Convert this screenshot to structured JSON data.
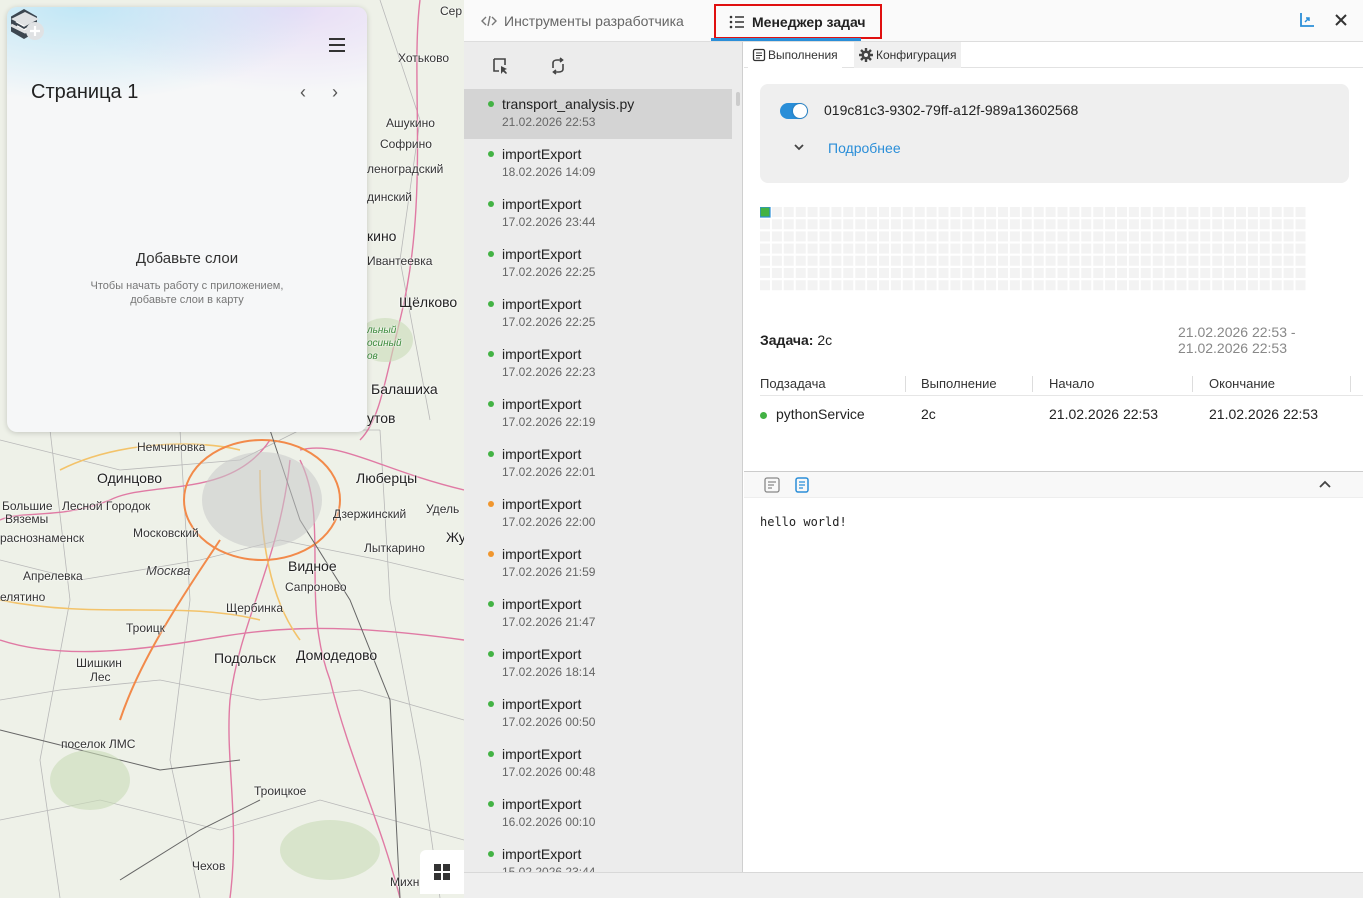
{
  "map": {
    "labels": [
      {
        "text": "Сер",
        "cls": ""
      },
      {
        "text": "Хотьково",
        "cls": ""
      },
      {
        "text": "Ашукино",
        "cls": ""
      },
      {
        "text": "Софрино",
        "cls": ""
      },
      {
        "text": "леноградский",
        "cls": ""
      },
      {
        "text": "динский",
        "cls": ""
      },
      {
        "text": "кино",
        "cls": "big"
      },
      {
        "text": "Ивантеевка",
        "cls": ""
      },
      {
        "text": "Щёлково",
        "cls": "big"
      },
      {
        "text": "Балашиха",
        "cls": "big"
      },
      {
        "text": "утов",
        "cls": "big"
      },
      {
        "text": "Немчиновка",
        "cls": ""
      },
      {
        "text": "Одинцово",
        "cls": "big"
      },
      {
        "text": "Люберцы",
        "cls": "big"
      },
      {
        "text": "Большие",
        "cls": ""
      },
      {
        "text": "Лесной Городок",
        "cls": ""
      },
      {
        "text": "Дзержинский",
        "cls": ""
      },
      {
        "text": "Удель",
        "cls": ""
      },
      {
        "text": "Вяземы",
        "cls": ""
      },
      {
        "text": "Московский",
        "cls": ""
      },
      {
        "text": "раснознаменск",
        "cls": ""
      },
      {
        "text": "Жу",
        "cls": "big"
      },
      {
        "text": "Лыткарино",
        "cls": ""
      },
      {
        "text": "Апрелевка",
        "cls": ""
      },
      {
        "text": "Москва",
        "cls": "city"
      },
      {
        "text": "Видное",
        "cls": "big"
      },
      {
        "text": "Сапроново",
        "cls": ""
      },
      {
        "text": "елятино",
        "cls": ""
      },
      {
        "text": "Щербинка",
        "cls": ""
      },
      {
        "text": "Троицк",
        "cls": ""
      },
      {
        "text": "Подольск",
        "cls": "big"
      },
      {
        "text": "Домодедово",
        "cls": "big"
      },
      {
        "text": "Шишкин",
        "cls": ""
      },
      {
        "text": "Лес",
        "cls": ""
      },
      {
        "text": "поселок ЛМС",
        "cls": ""
      },
      {
        "text": "Троицкое",
        "cls": ""
      },
      {
        "text": "Чехов",
        "cls": ""
      },
      {
        "text": "Михн",
        "cls": ""
      },
      {
        "text": "льный",
        "cls": "green"
      },
      {
        "text": "осиный",
        "cls": "green"
      },
      {
        "text": "ов",
        "cls": "green"
      }
    ]
  },
  "layers_panel": {
    "title": "Страница 1",
    "empty_title": "Добавьте слои",
    "empty_text": "Чтобы начать работу с приложением, добавьте слои в карту"
  },
  "tabs": {
    "devtools": "Инструменты разработчика",
    "tasks": "Менеджер задач"
  },
  "tasks": [
    {
      "name": "transport_analysis.py",
      "date": "21.02.2026 22:53",
      "status": "#43b244",
      "selected": true
    },
    {
      "name": "importExport",
      "date": "18.02.2026 14:09",
      "status": "#43b244"
    },
    {
      "name": "importExport",
      "date": "17.02.2026 23:44",
      "status": "#43b244"
    },
    {
      "name": "importExport",
      "date": "17.02.2026 22:25",
      "status": "#43b244"
    },
    {
      "name": "importExport",
      "date": "17.02.2026 22:25",
      "status": "#43b244"
    },
    {
      "name": "importExport",
      "date": "17.02.2026 22:23",
      "status": "#43b244"
    },
    {
      "name": "importExport",
      "date": "17.02.2026 22:19",
      "status": "#43b244"
    },
    {
      "name": "importExport",
      "date": "17.02.2026 22:01",
      "status": "#43b244"
    },
    {
      "name": "importExport",
      "date": "17.02.2026 22:00",
      "status": "#f0962e"
    },
    {
      "name": "importExport",
      "date": "17.02.2026 21:59",
      "status": "#f0962e"
    },
    {
      "name": "importExport",
      "date": "17.02.2026 21:47",
      "status": "#43b244"
    },
    {
      "name": "importExport",
      "date": "17.02.2026 18:14",
      "status": "#43b244"
    },
    {
      "name": "importExport",
      "date": "17.02.2026 00:50",
      "status": "#43b244"
    },
    {
      "name": "importExport",
      "date": "17.02.2026 00:48",
      "status": "#43b244"
    },
    {
      "name": "importExport",
      "date": "16.02.2026 00:10",
      "status": "#43b244"
    },
    {
      "name": "importExport",
      "date": "15.02.2026 23:44",
      "status": "#43b244"
    }
  ],
  "details": {
    "subtabs": {
      "runs": "Выполнения",
      "config": "Конфигурация"
    },
    "run_id": "019c81c3-9302-79ff-a12f-989a13602568",
    "toggle_on": true,
    "more_link": "Подробнее",
    "task_label": "Задача:",
    "task_value": "2с",
    "range_start": "21.02.2026 22:53 -",
    "range_end": "21.02.2026 22:53",
    "subtask_columns": [
      "Подзадача",
      "Выполнение",
      "Начало",
      "Окончание"
    ],
    "subtasks": [
      {
        "name": "pythonService",
        "duration": "2с",
        "start": "21.02.2026 22:53",
        "end": "21.02.2026 22:53",
        "status": "#43b244"
      }
    ]
  },
  "heatmap": {
    "active_cells": 1,
    "active_color": "#43b244",
    "cell_color": "#f3f3f3"
  },
  "console": {
    "output": "hello world!"
  },
  "colors": {
    "accent": "#2a8ed8",
    "highlight": "#e01010",
    "success": "#43b244",
    "warning": "#f0962e"
  }
}
